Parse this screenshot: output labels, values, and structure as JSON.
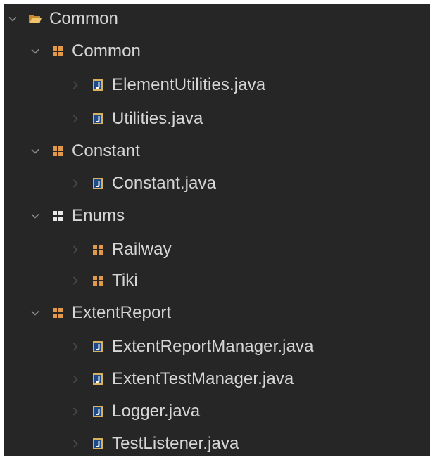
{
  "colors": {
    "panel_bg": "#262626",
    "text": "#d6d6d6",
    "chevron": "#8a8a8a",
    "chevron_dim": "#4a4a4a",
    "package": "#e09a4a",
    "package_empty": "#e8e8e8",
    "java_file": "#d7b25a",
    "folder": "#efc46b"
  },
  "tree": {
    "root": {
      "label": "Common",
      "icon": "folder-open-icon",
      "expanded": true
    },
    "packages": [
      {
        "label": "Common",
        "icon": "package-icon",
        "expanded": true,
        "children": [
          {
            "label": "ElementUtilities.java",
            "icon": "java-file-icon"
          },
          {
            "label": "Utilities.java",
            "icon": "java-file-icon"
          }
        ]
      },
      {
        "label": "Constant",
        "icon": "package-icon",
        "expanded": true,
        "children": [
          {
            "label": "Constant.java",
            "icon": "java-file-icon"
          }
        ]
      },
      {
        "label": "Enums",
        "icon": "package-empty-icon",
        "expanded": true,
        "children": [
          {
            "label": "Railway",
            "icon": "package-icon"
          },
          {
            "label": "Tiki",
            "icon": "package-icon"
          }
        ]
      },
      {
        "label": "ExtentReport",
        "icon": "package-icon",
        "expanded": true,
        "children": [
          {
            "label": "ExtentReportManager.java",
            "icon": "java-file-icon"
          },
          {
            "label": "ExtentTestManager.java",
            "icon": "java-file-icon"
          },
          {
            "label": "Logger.java",
            "icon": "java-file-icon"
          },
          {
            "label": "TestListener.java",
            "icon": "java-file-icon"
          }
        ]
      }
    ]
  }
}
